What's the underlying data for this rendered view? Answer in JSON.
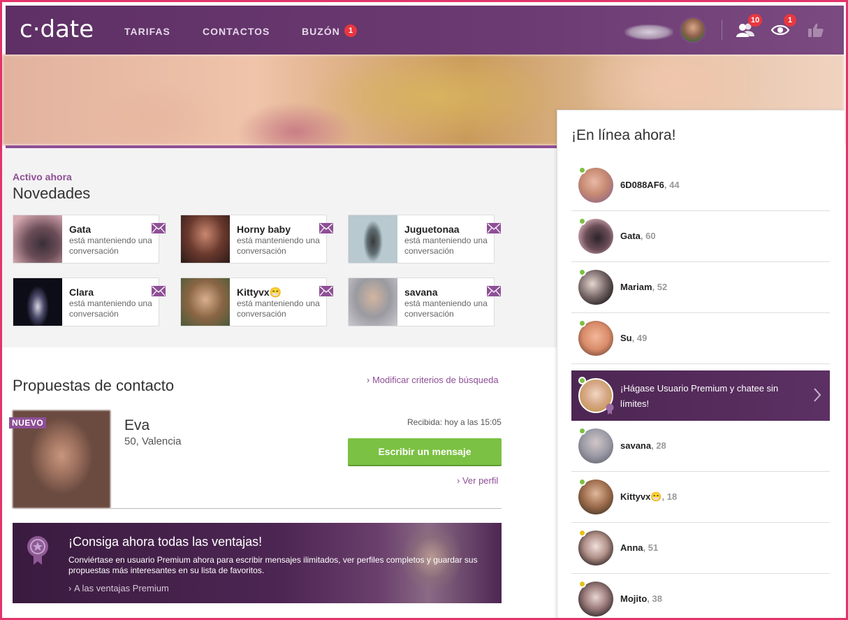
{
  "header": {
    "logo": "c·date",
    "nav": [
      "TARIFAS",
      "CONTACTOS",
      "BUZÓN"
    ],
    "buzon_badge": "1",
    "contacts_badge": "10",
    "visitors_badge": "1"
  },
  "novedades": {
    "active_label": "Activo ahora",
    "title": "Novedades",
    "cards": [
      {
        "name": "Gata",
        "status": "está manteniendo una conversación"
      },
      {
        "name": "Horny baby",
        "status": "está manteniendo una conversación"
      },
      {
        "name": "Juguetonaa",
        "status": "está manteniendo una conversación"
      },
      {
        "name": "Clara",
        "status": "está manteniendo una conversación"
      },
      {
        "name": "Kittyvx😁",
        "status": "está manteniendo una conversación"
      },
      {
        "name": "savana",
        "status": "está manteniendo una conversación"
      }
    ]
  },
  "proposals": {
    "title": "Propuestas de contacto",
    "modify_link": "Modificar criterios de búsqueda",
    "badge": "NUEVO",
    "name": "Eva",
    "location": "50, Valencia",
    "received": "Recibida: hoy a las 15:05",
    "write_button": "Escribir un mensaje",
    "profile_link": "Ver perfil"
  },
  "banner": {
    "title": "¡Consiga ahora todas las ventajas!",
    "text": "Conviértase en usuario Premium ahora para escribir mensajes ilimitados, ver perfiles completos y guardar sus propuestas más interesantes en su lista de favoritos.",
    "link": "A las ventajas Premium"
  },
  "online": {
    "title": "¡En línea ahora!",
    "users": [
      {
        "name": "6D088AF6",
        "age": "44",
        "status": "online"
      },
      {
        "name": "Gata",
        "age": "60",
        "status": "online"
      },
      {
        "name": "Mariam",
        "age": "52",
        "status": "online"
      },
      {
        "name": "Su",
        "age": "49",
        "status": "online"
      },
      {
        "name": "savana",
        "age": "28",
        "status": "online"
      },
      {
        "name": "Kittyvx😁",
        "age": "18",
        "status": "online"
      },
      {
        "name": "Anna",
        "age": "51",
        "status": "away"
      },
      {
        "name": "Mojito",
        "age": "38",
        "status": "away"
      }
    ],
    "promo": "¡Hágase Usuario Premium y chatee sin límites!"
  },
  "colors": {
    "brand": "#5e3065",
    "accent": "#8e4f96",
    "cta": "#7bc143",
    "badge": "#e8373f",
    "online": "#7bc143",
    "away": "#e6c21b"
  }
}
